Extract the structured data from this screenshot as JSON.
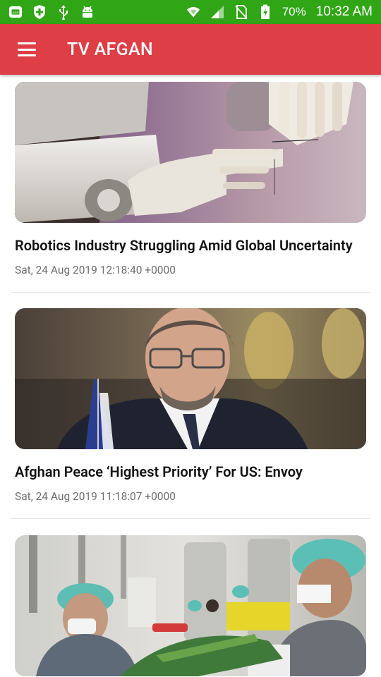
{
  "status_bar": {
    "battery_percent": "70%",
    "time": "10:32 AM",
    "left_icons": [
      "app-notification-icon",
      "shield-plus-icon",
      "usb-icon",
      "android-debug-icon"
    ],
    "right_icons": [
      "wifi-icon",
      "cell-signal-icon",
      "no-sim-icon",
      "battery-icon"
    ],
    "color": "#30a515"
  },
  "app_bar": {
    "title": "TV AFGAN",
    "color": "#de3e46"
  },
  "articles": [
    {
      "title": "Robotics Industry Struggling Amid Global Uncertainty",
      "date": "Sat, 24 Aug 2019 12:18:40 +0000",
      "image": "robot-hands-photo"
    },
    {
      "title": "Afghan Peace ‘Highest Priority’ For US: Envoy",
      "date": "Sat, 24 Aug 2019 11:18:07 +0000",
      "image": "envoy-portrait-photo"
    },
    {
      "title": "",
      "date": "",
      "image": "factory-workers-photo"
    }
  ]
}
